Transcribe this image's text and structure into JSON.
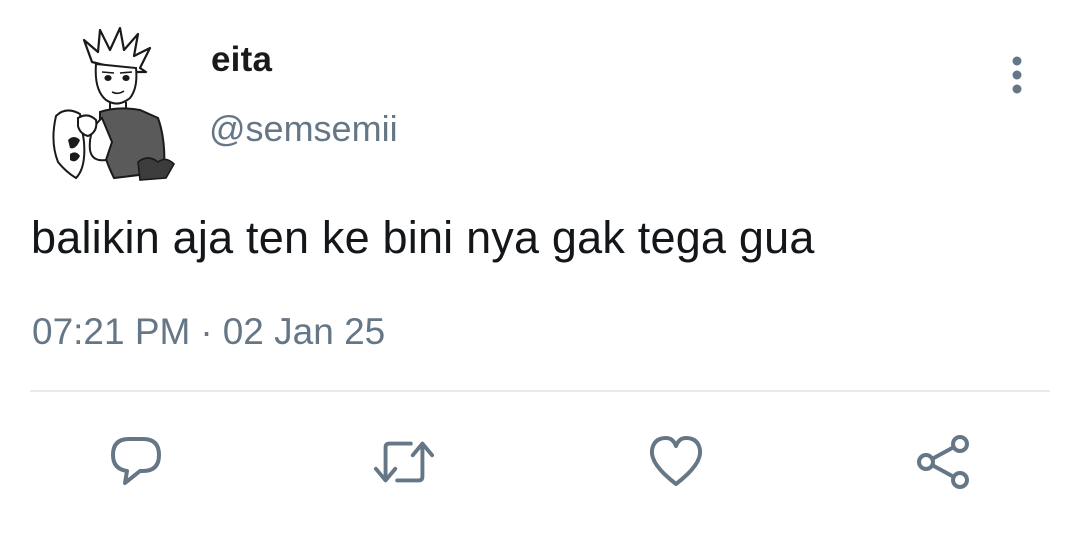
{
  "tweet": {
    "display_name": "eita",
    "handle": "@semsemii",
    "text": "balikin aja ten ke bini nya gak tega gua",
    "time": "07:21 PM",
    "separator": "·",
    "date": "02 Jan 25"
  },
  "icons": {
    "more": "more-vertical-icon",
    "reply": "reply-bubble-icon",
    "retweet": "retweet-icon",
    "like": "heart-icon",
    "share": "share-icon"
  },
  "colors": {
    "text": "#14171a",
    "secondary": "#657786",
    "divider": "#e6ecf0",
    "background": "#ffffff"
  }
}
